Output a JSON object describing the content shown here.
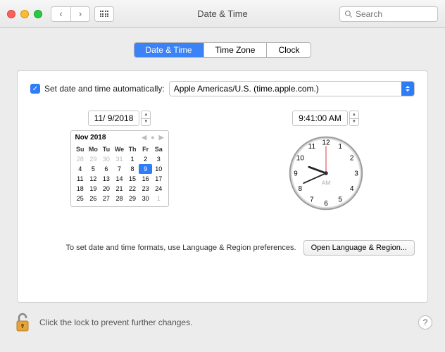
{
  "window": {
    "title": "Date & Time"
  },
  "search": {
    "placeholder": "Search"
  },
  "tabs": {
    "t0": "Date & Time",
    "t1": "Time Zone",
    "t2": "Clock"
  },
  "auto": {
    "label": "Set date and time automatically:",
    "server": "Apple Americas/U.S. (time.apple.com.)"
  },
  "date": {
    "value": "11/ 9/2018"
  },
  "time": {
    "value": "9:41:00 AM",
    "meridiem": "AM"
  },
  "calendar": {
    "month_label": "Nov 2018",
    "days": {
      "d0": "Su",
      "d1": "Mo",
      "d2": "Tu",
      "d3": "We",
      "d4": "Th",
      "d5": "Fr",
      "d6": "Sa"
    },
    "cells": {
      "c0": "28",
      "c1": "29",
      "c2": "30",
      "c3": "31",
      "c4": "1",
      "c5": "2",
      "c6": "3",
      "c7": "4",
      "c8": "5",
      "c9": "6",
      "c10": "7",
      "c11": "8",
      "c12": "9",
      "c13": "10",
      "c14": "11",
      "c15": "12",
      "c16": "13",
      "c17": "14",
      "c18": "15",
      "c19": "16",
      "c20": "17",
      "c21": "18",
      "c22": "19",
      "c23": "20",
      "c24": "21",
      "c25": "22",
      "c26": "23",
      "c27": "24",
      "c28": "25",
      "c29": "26",
      "c30": "27",
      "c31": "28",
      "c32": "29",
      "c33": "30",
      "c34": "1"
    }
  },
  "clock_face": {
    "h12": "12",
    "h1": "1",
    "h2": "2",
    "h3": "3",
    "h4": "4",
    "h5": "5",
    "h6": "6",
    "h7": "7",
    "h8": "8",
    "h9": "9",
    "h10": "10",
    "h11": "11"
  },
  "format": {
    "text": "To set date and time formats, use Language & Region preferences.",
    "button": "Open Language & Region..."
  },
  "footer": {
    "lock_text": "Click the lock to prevent further changes.",
    "help": "?"
  }
}
